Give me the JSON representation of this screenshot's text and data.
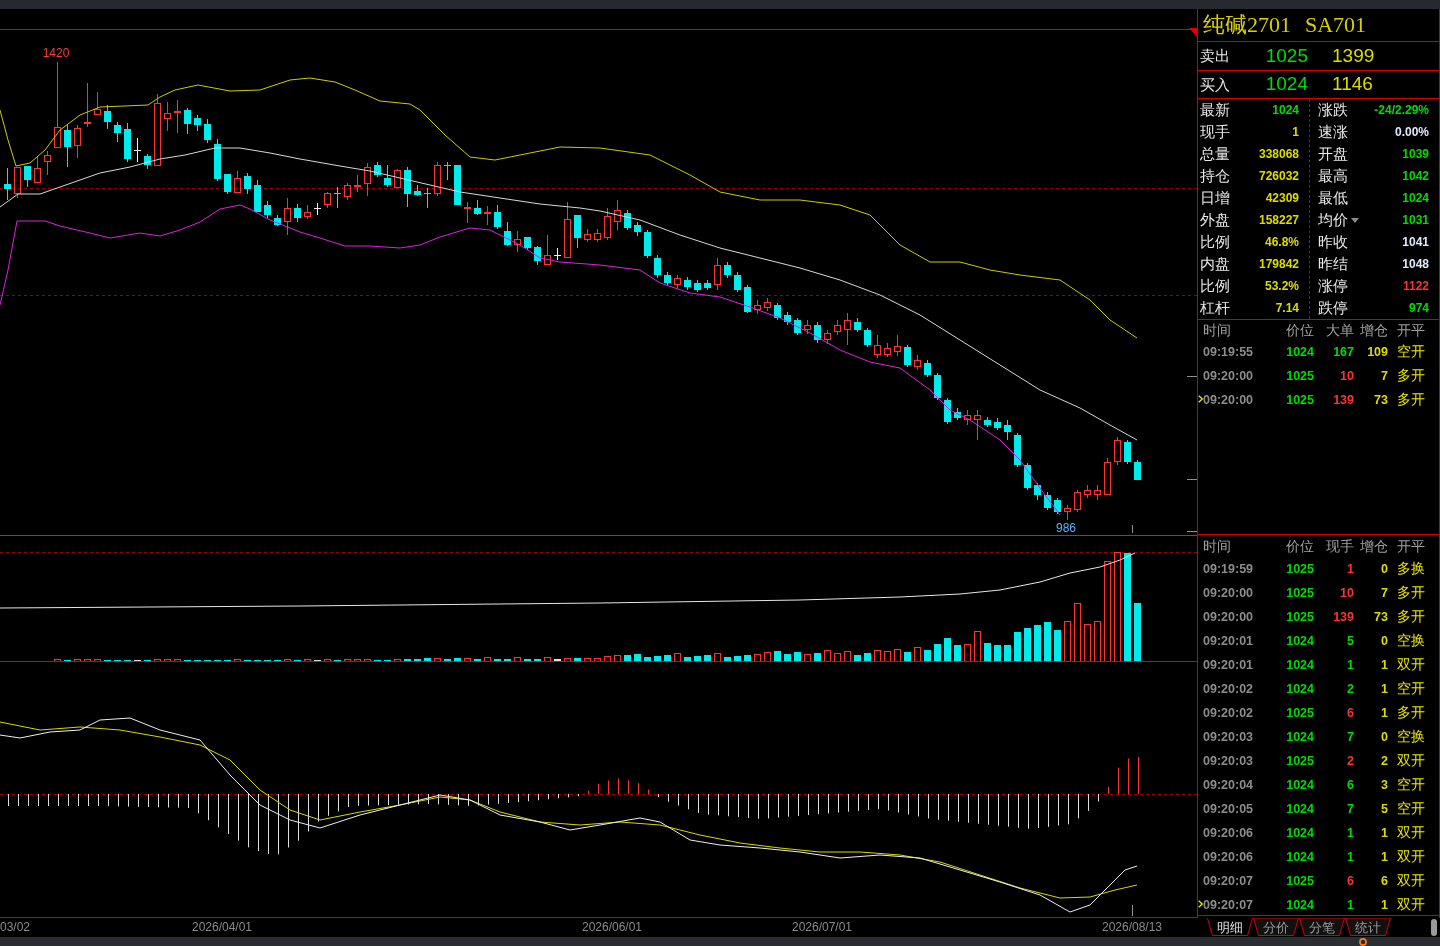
{
  "chart": {
    "high_label": "1420",
    "low_label": "986",
    "date_labels": [
      "03/02",
      "2026/04/01",
      "2026/06/01",
      "2026/07/01",
      "2026/08/13"
    ]
  },
  "instrument": {
    "name": "纯碱2701",
    "code": "SA701"
  },
  "quotes": [
    {
      "label": "卖出",
      "price": "1025",
      "volume": "1399"
    },
    {
      "label": "买入",
      "price": "1024",
      "volume": "1146"
    }
  ],
  "stats": [
    [
      {
        "label": "最新",
        "value": "1024",
        "color": "#00dc00",
        "dropdown": false
      },
      {
        "label": "涨跌",
        "value": "-24/2.29%",
        "color": "#00dc00",
        "dropdown": false
      }
    ],
    [
      {
        "label": "现手",
        "value": "1",
        "color": "#dcdc00",
        "dropdown": false
      },
      {
        "label": "速涨",
        "value": "0.00%",
        "color": "#e0e8ff",
        "dropdown": false
      }
    ],
    [
      {
        "label": "总量",
        "value": "338068",
        "color": "#dcdc00",
        "dropdown": false
      },
      {
        "label": "开盘",
        "value": "1039",
        "color": "#00dc00",
        "dropdown": false
      }
    ],
    [
      {
        "label": "持仓",
        "value": "726032",
        "color": "#dcdc00",
        "dropdown": false
      },
      {
        "label": "最高",
        "value": "1042",
        "color": "#00dc00",
        "dropdown": false
      }
    ],
    [
      {
        "label": "日增",
        "value": "42309",
        "color": "#dcdc00",
        "dropdown": false
      },
      {
        "label": "最低",
        "value": "1024",
        "color": "#00dc00",
        "dropdown": false
      }
    ],
    [
      {
        "label": "外盘",
        "value": "158227",
        "color": "#dcdc00",
        "dropdown": false
      },
      {
        "label": "均价",
        "value": "1031",
        "color": "#00dc00",
        "dropdown": true
      }
    ],
    [
      {
        "label": "比例",
        "value": "46.8%",
        "color": "#dcdc00",
        "dropdown": false
      },
      {
        "label": "昨收",
        "value": "1041",
        "color": "#e0e8ff",
        "dropdown": false
      }
    ],
    [
      {
        "label": "内盘",
        "value": "179842",
        "color": "#dcdc00",
        "dropdown": false
      },
      {
        "label": "昨结",
        "value": "1048",
        "color": "#e0e8ff",
        "dropdown": false
      }
    ],
    [
      {
        "label": "比例",
        "value": "53.2%",
        "color": "#dcdc00",
        "dropdown": false
      },
      {
        "label": "涨停",
        "value": "1122",
        "color": "#ff3232",
        "dropdown": false
      }
    ],
    [
      {
        "label": "杠杆",
        "value": "7.14",
        "color": "#dcdc00",
        "dropdown": false
      },
      {
        "label": "跌停",
        "value": "974",
        "color": "#00dc00",
        "dropdown": false
      }
    ]
  ],
  "big_orders": {
    "columns": [
      "时间",
      "价位",
      "大单",
      "增仓",
      "开平"
    ],
    "rows": [
      {
        "time": "09:19:55",
        "price": "1024",
        "size": "167",
        "color": "#00dc00",
        "oi_change": "109",
        "action": "空开",
        "current": false
      },
      {
        "time": "09:20:00",
        "price": "1025",
        "size": "10",
        "color": "#ff3232",
        "oi_change": "7",
        "action": "多开",
        "current": false
      },
      {
        "time": "09:20:00",
        "price": "1025",
        "size": "139",
        "color": "#ff3232",
        "oi_change": "73",
        "action": "多开",
        "current": true
      }
    ]
  },
  "trades": {
    "columns": [
      "时间",
      "价位",
      "现手",
      "增仓",
      "开平"
    ],
    "rows": [
      {
        "time": "09:19:59",
        "price": "1025",
        "size": "1",
        "color": "#ff3232",
        "oi_change": "0",
        "action": "多换",
        "current": false
      },
      {
        "time": "09:20:00",
        "price": "1025",
        "size": "10",
        "color": "#ff3232",
        "oi_change": "7",
        "action": "多开",
        "current": false
      },
      {
        "time": "09:20:00",
        "price": "1025",
        "size": "139",
        "color": "#ff3232",
        "oi_change": "73",
        "action": "多开",
        "current": false
      },
      {
        "time": "09:20:01",
        "price": "1024",
        "size": "5",
        "color": "#00dc00",
        "oi_change": "0",
        "action": "空换",
        "current": false
      },
      {
        "time": "09:20:01",
        "price": "1024",
        "size": "1",
        "color": "#00dc00",
        "oi_change": "1",
        "action": "双开",
        "current": false
      },
      {
        "time": "09:20:02",
        "price": "1024",
        "size": "2",
        "color": "#00dc00",
        "oi_change": "1",
        "action": "空开",
        "current": false
      },
      {
        "time": "09:20:02",
        "price": "1025",
        "size": "6",
        "color": "#ff3232",
        "oi_change": "1",
        "action": "多开",
        "current": false
      },
      {
        "time": "09:20:03",
        "price": "1024",
        "size": "7",
        "color": "#00dc00",
        "oi_change": "0",
        "action": "空换",
        "current": false
      },
      {
        "time": "09:20:03",
        "price": "1025",
        "size": "2",
        "color": "#ff3232",
        "oi_change": "2",
        "action": "双开",
        "current": false
      },
      {
        "time": "09:20:04",
        "price": "1024",
        "size": "6",
        "color": "#00dc00",
        "oi_change": "3",
        "action": "空开",
        "current": false
      },
      {
        "time": "09:20:05",
        "price": "1024",
        "size": "7",
        "color": "#00dc00",
        "oi_change": "5",
        "action": "空开",
        "current": false
      },
      {
        "time": "09:20:06",
        "price": "1024",
        "size": "1",
        "color": "#00dc00",
        "oi_change": "1",
        "action": "双开",
        "current": false
      },
      {
        "time": "09:20:06",
        "price": "1024",
        "size": "1",
        "color": "#00dc00",
        "oi_change": "1",
        "action": "双开",
        "current": false
      },
      {
        "time": "09:20:07",
        "price": "1025",
        "size": "6",
        "color": "#ff3232",
        "oi_change": "6",
        "action": "双开",
        "current": false
      },
      {
        "time": "09:20:07",
        "price": "1024",
        "size": "1",
        "color": "#00dc00",
        "oi_change": "1",
        "action": "双开",
        "current": true
      }
    ]
  },
  "tabs": [
    {
      "label": "明细",
      "selected": true
    },
    {
      "label": "分价",
      "selected": false
    },
    {
      "label": "分笔",
      "selected": false
    },
    {
      "label": "统计",
      "selected": false
    }
  ]
}
